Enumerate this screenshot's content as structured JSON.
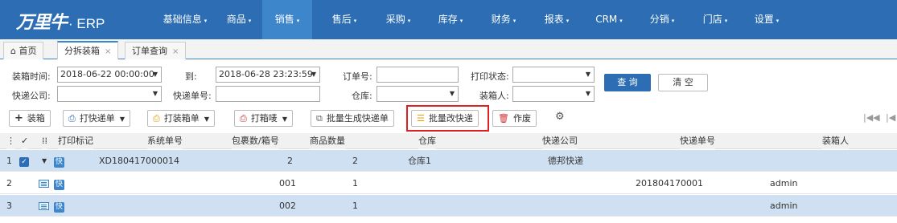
{
  "app": {
    "logo_text": "万里牛",
    "logo_suffix": "· ERP"
  },
  "nav": [
    {
      "label": "基础信息",
      "caret": "▾"
    },
    {
      "label": "商品",
      "caret": "▾"
    },
    {
      "label": "销售",
      "caret": "▾"
    },
    {
      "label": "售后",
      "caret": "▾"
    },
    {
      "label": "采购",
      "caret": "▾"
    },
    {
      "label": "库存",
      "caret": "▾"
    },
    {
      "label": "财务",
      "caret": "▾"
    },
    {
      "label": "报表",
      "caret": "▾"
    },
    {
      "label": "CRM",
      "caret": "▾"
    },
    {
      "label": "分销",
      "caret": "▾"
    },
    {
      "label": "门店",
      "caret": "▾"
    },
    {
      "label": "设置",
      "caret": "▾"
    }
  ],
  "tabs": [
    {
      "icon": "⌂",
      "label": "首页"
    },
    {
      "label": "分拆装箱",
      "close": "×"
    },
    {
      "label": "订单查询",
      "close": "×"
    }
  ],
  "filters": {
    "boxing_time_label": "装箱时间:",
    "boxing_time_from": "2018-06-22 00:00:00",
    "to_label": "到:",
    "boxing_time_to": "2018-06-28 23:23:59",
    "order_no_label": "订单号:",
    "order_no_value": "",
    "print_status_label": "打印状态:",
    "print_status_value": "",
    "express_company_label": "快递公司:",
    "express_company_value": "",
    "express_no_label": "快递单号:",
    "express_no_value": "",
    "warehouse_label": "仓库:",
    "warehouse_value": "",
    "packer_label": "装箱人:",
    "packer_value": "",
    "query_button": "查 询",
    "clear_button": "清 空"
  },
  "toolbar": {
    "boxing": "装箱",
    "print_express": "打快递单",
    "print_box": "打装箱单",
    "print_box_label": "打箱唛",
    "batch_generate": "批量生成快递单",
    "batch_change": "批量改快递",
    "void": "作废"
  },
  "columns": [
    "打印标记",
    "系统单号",
    "包裹数/箱号",
    "商品数量",
    "仓库",
    "快递公司",
    "快递单号",
    "装箱人"
  ],
  "rows": [
    {
      "index": "1",
      "print_mark": "快",
      "system_no": "XD180417000014",
      "package": "2",
      "qty": "2",
      "warehouse": "仓库1",
      "express_company": "德邦快递",
      "express_no": "",
      "packer": ""
    },
    {
      "index": "2",
      "print_mark": "快",
      "system_no": "",
      "package": "001",
      "qty": "1",
      "warehouse": "",
      "express_company": "",
      "express_no": "201804170001",
      "packer": "admin"
    },
    {
      "index": "3",
      "print_mark": "快",
      "system_no": "",
      "package": "002",
      "qty": "1",
      "warehouse": "",
      "express_company": "",
      "express_no": "",
      "packer": "admin"
    }
  ],
  "colors": {
    "nav_bg": "#2c6db3",
    "nav_active": "#3d86cc",
    "row_highlight": "#cfe0f2",
    "highlight_box": "#e02020"
  }
}
